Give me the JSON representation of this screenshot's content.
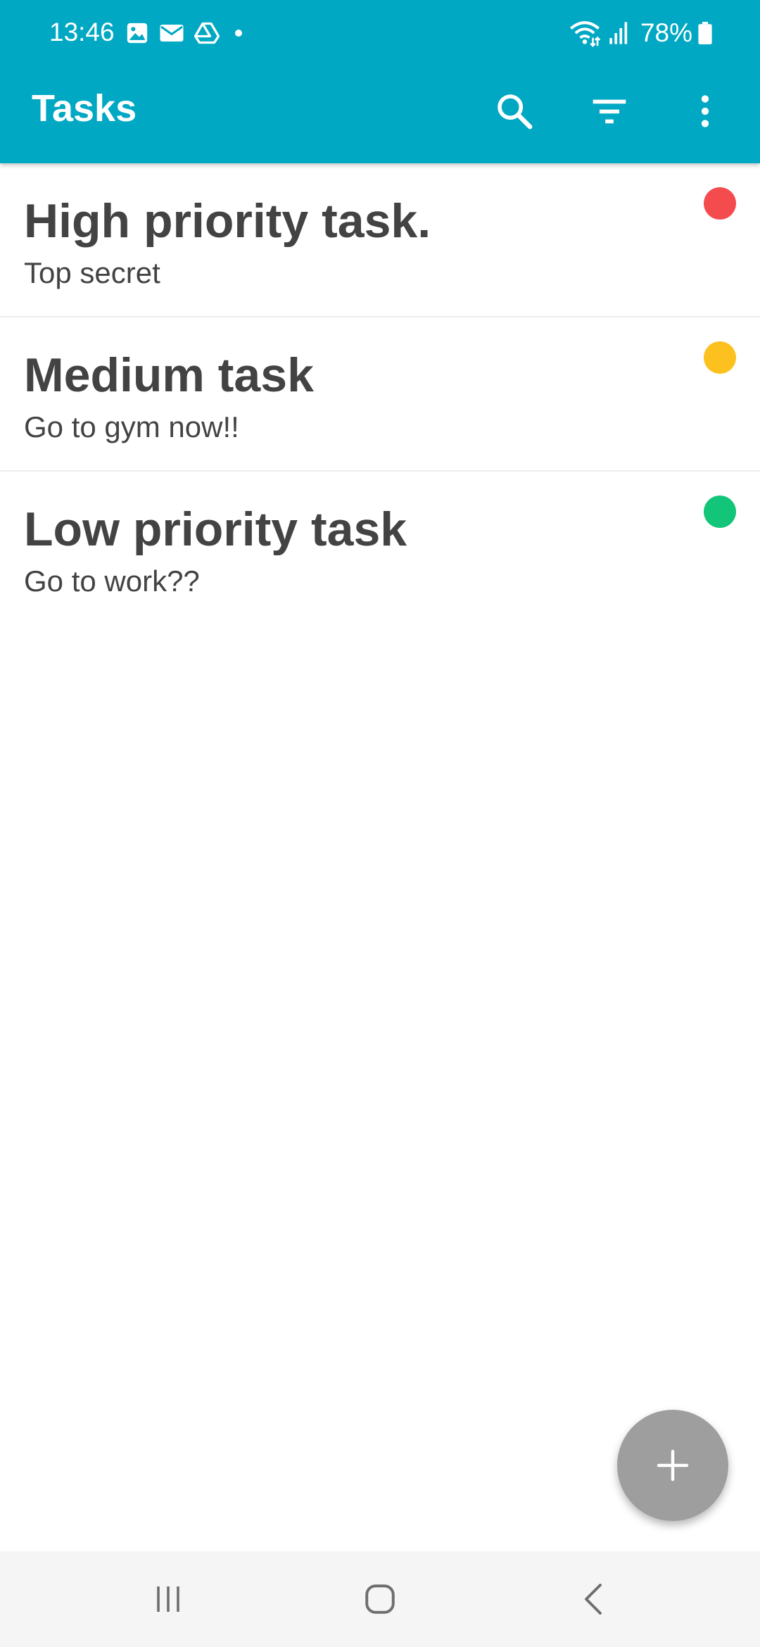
{
  "status_bar": {
    "time": "13:46",
    "battery": "78%",
    "left_icons": [
      "gallery-icon",
      "email-icon",
      "drive-icon",
      "dot-icon"
    ],
    "right_icons": [
      "wifi-icon",
      "signal-icon",
      "battery-icon"
    ]
  },
  "app_bar": {
    "title": "Tasks",
    "actions": [
      "search-icon",
      "filter-icon",
      "more-vert-icon"
    ],
    "background": "#00a8c3"
  },
  "tasks": [
    {
      "title": "High priority task.",
      "description": "Top secret",
      "priority": "high",
      "color": "#f44b4f"
    },
    {
      "title": "Medium task",
      "description": "Go to gym now!!",
      "priority": "medium",
      "color": "#fdc11f"
    },
    {
      "title": "Low priority task",
      "description": "Go to work??",
      "priority": "low",
      "color": "#13c579"
    }
  ],
  "fab": {
    "icon": "plus-icon",
    "color": "#9e9e9e"
  },
  "nav_bar": {
    "buttons": [
      "recents-icon",
      "home-icon",
      "back-icon"
    ]
  }
}
